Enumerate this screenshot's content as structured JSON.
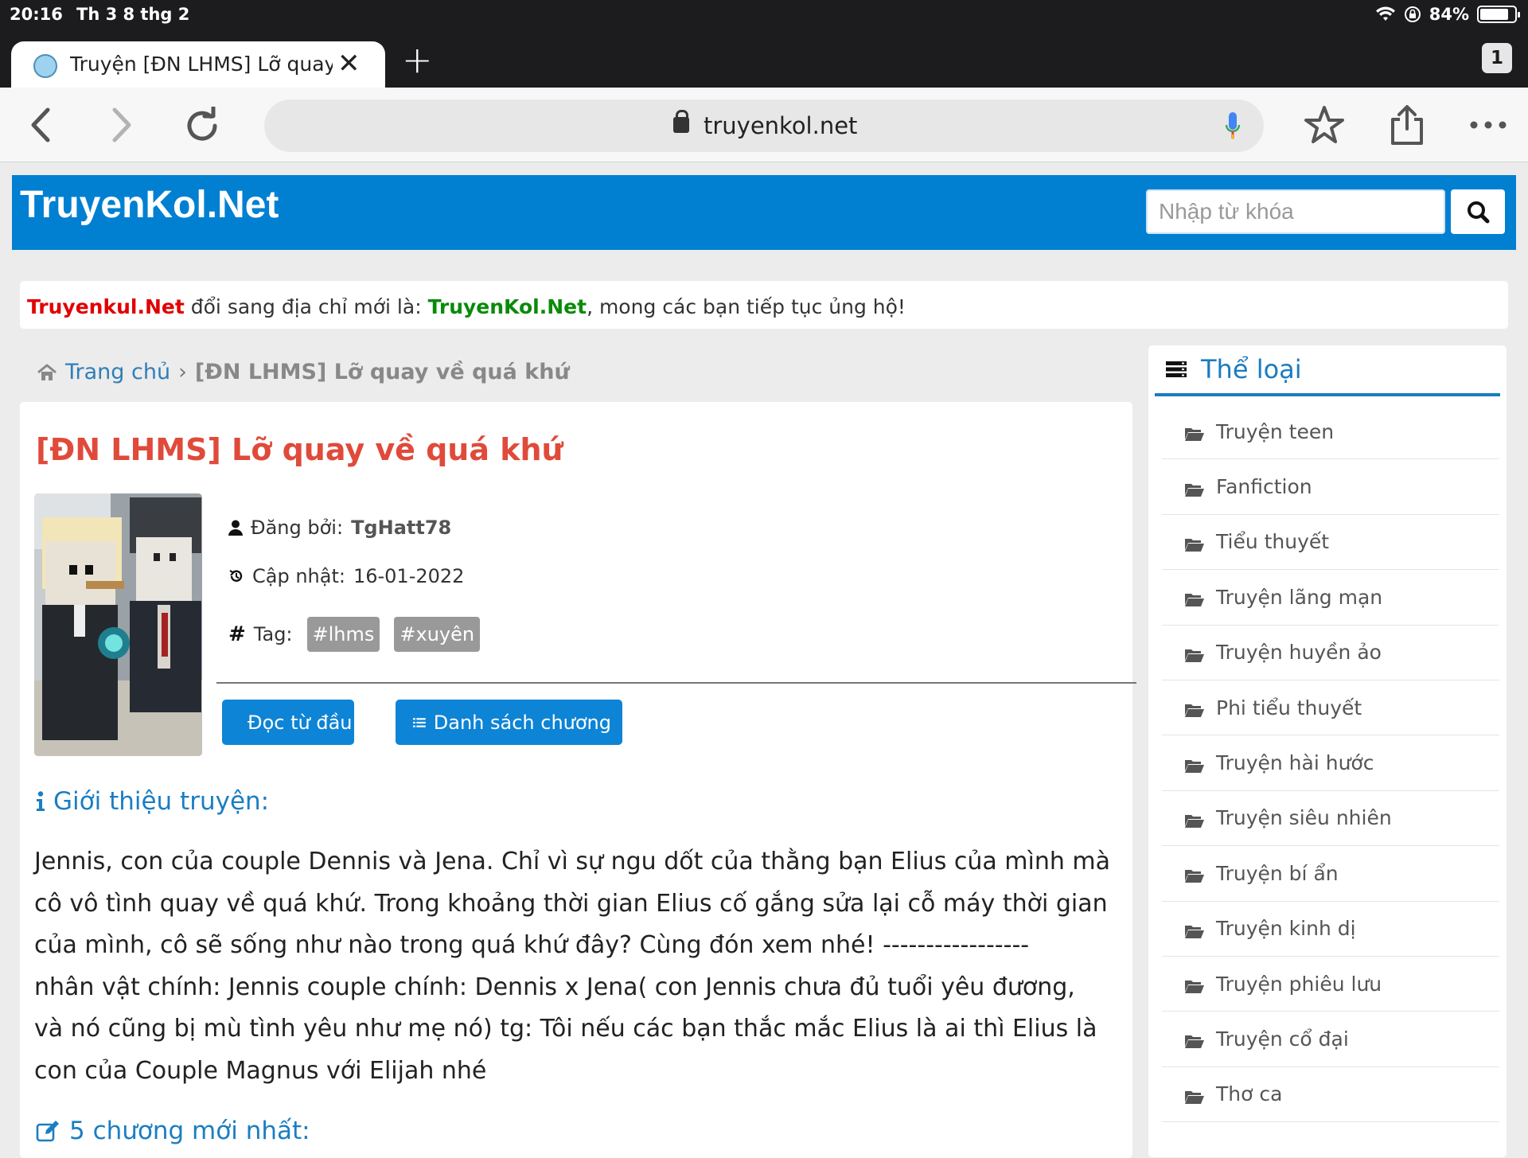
{
  "status": {
    "time": "20:16",
    "date": "Th 3 8 thg 2",
    "battery": "84%",
    "battery_level": 0.84
  },
  "browser": {
    "tab_title": "Truyện [ĐN LHMS] Lỡ quay",
    "tab_count": "1",
    "url": "truyenkol.net"
  },
  "site": {
    "logo": "TruyenKol.Net",
    "search_placeholder": "Nhập từ khóa",
    "colors": {
      "brand": "#0180d2",
      "title": "#e04a3a",
      "link": "#1a7ec2"
    }
  },
  "notice": {
    "old_domain": "Truyenkul.Net",
    "middle": " đổi sang địa chỉ mới là: ",
    "new_domain": "TruyenKol.Net",
    "tail": ", mong các bạn tiếp tục ủng hộ!"
  },
  "breadcrumb": {
    "home": "Trang chủ",
    "separator": "›",
    "current": "[ĐN LHMS] Lỡ quay về quá khứ"
  },
  "story": {
    "title": "[ĐN LHMS] Lỡ quay về quá khứ",
    "posted_label": "Đăng bởi:",
    "author": "TgHatt78",
    "updated_label": "Cập nhật:",
    "updated": "16-01-2022",
    "tag_label": "Tag:",
    "tags": [
      "#lhms",
      "#xuyên"
    ],
    "read_button": "Đọc từ đầu",
    "chapters_button": "Danh sách chương",
    "intro_heading": "Giới thiệu truyện:",
    "intro_lines": [
      "Jennis, con của couple Dennis và Jena. Chỉ vì sự ngu dốt của thằng bạn Elius của mình mà",
      "cô vô tình quay về quá khứ. Trong khoảng thời gian Elius cố gắng sửa lại cỗ máy thời gian",
      "của mình, cô sẽ sống như nào trong quá khứ đây? Cùng đón xem nhé! -----------------",
      "nhân vật chính: Jennis couple chính: Dennis x Jena( con Jennis chưa đủ tuổi yêu đương,",
      "và nó cũng bị mù tình yêu như mẹ nó) tg: Tôi nếu các bạn thắc mắc Elius là ai thì Elius là",
      "con của Couple Magnus với Elijah nhé"
    ],
    "latest_heading": "5 chương mới nhất:"
  },
  "sidebar": {
    "heading": "Thể loại",
    "categories": [
      "Truyện teen",
      "Fanfiction",
      "Tiểu thuyết",
      "Truyện lãng mạn",
      "Truyện huyền ảo",
      "Phi tiểu thuyết",
      "Truyện hài hước",
      "Truyện siêu nhiên",
      "Truyện bí ẩn",
      "Truyện kinh dị",
      "Truyện phiêu lưu",
      "Truyện cổ đại",
      "Thơ ca"
    ]
  }
}
